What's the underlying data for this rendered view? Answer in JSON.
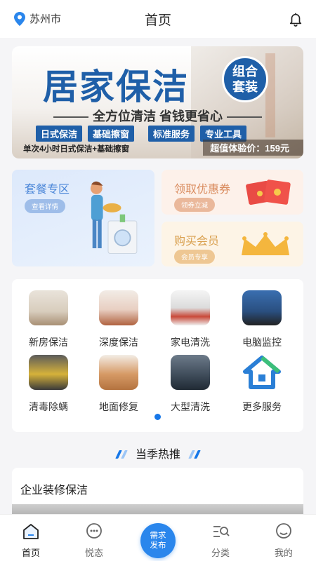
{
  "header": {
    "location": "苏州市",
    "title": "首页"
  },
  "banner": {
    "title": "居家保洁",
    "badge": "组合\n套装",
    "subtitle": "全方位清洁  省钱更省心",
    "tags": [
      "日式保洁",
      "基础擦窗",
      "标准服务",
      "专业工具"
    ],
    "note": "单次4小时日式保洁+基础擦窗",
    "price": "超值体验价：159元"
  },
  "promos": {
    "package": {
      "title": "套餐专区",
      "button": "查看详情"
    },
    "coupon": {
      "title": "领取优惠券",
      "button": "领券立减"
    },
    "member": {
      "title": "购买会员",
      "button": "会员专享"
    }
  },
  "services": [
    {
      "label": "新房保洁",
      "icon": "new-house-icon"
    },
    {
      "label": "深度保洁",
      "icon": "deep-clean-icon"
    },
    {
      "label": "家电清洗",
      "icon": "appliance-icon"
    },
    {
      "label": "电脑监控",
      "icon": "computer-icon"
    },
    {
      "label": "清毒除螨",
      "icon": "disinfect-icon"
    },
    {
      "label": "地面修复",
      "icon": "floor-icon"
    },
    {
      "label": "大型清洗",
      "icon": "large-clean-icon"
    },
    {
      "label": "更多服务",
      "icon": "more-services-icon"
    }
  ],
  "section": {
    "title": "当季热推"
  },
  "featured": {
    "title": "企业装修保洁"
  },
  "tabbar": {
    "home": "首页",
    "moments": "悦态",
    "publish": "需求\n发布",
    "category": "分类",
    "mine": "我的"
  },
  "colors": {
    "accent": "#1677e8",
    "brand": "#1f5fa8"
  }
}
